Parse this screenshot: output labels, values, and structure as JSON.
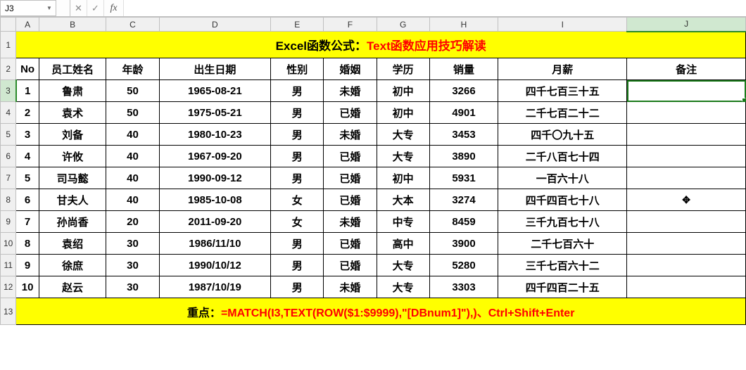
{
  "formula_bar": {
    "name_box": "J3",
    "cancel": "✕",
    "confirm": "✓",
    "fx": "fx",
    "formula_value": ""
  },
  "columns": [
    "A",
    "B",
    "C",
    "D",
    "E",
    "F",
    "G",
    "H",
    "I",
    "J"
  ],
  "row_numbers": [
    "1",
    "2",
    "3",
    "4",
    "5",
    "6",
    "7",
    "8",
    "9",
    "10",
    "11",
    "12",
    "13"
  ],
  "selected": {
    "col": "J",
    "row": "3",
    "cell": "J3"
  },
  "title": {
    "left": "Excel函数公式：",
    "right": "Text函数应用技巧解读"
  },
  "headers": {
    "A": "No",
    "B": "员工姓名",
    "C": "年龄",
    "D": "出生日期",
    "E": "性别",
    "F": "婚姻",
    "G": "学历",
    "H": "销量",
    "I": "月薪",
    "J": "备注"
  },
  "rows": [
    {
      "no": "1",
      "name": "鲁肃",
      "age": "50",
      "birth": "1965-08-21",
      "sex": "男",
      "mar": "未婚",
      "edu": "初中",
      "sales": "3266",
      "salary": "四千七百三十五",
      "note": ""
    },
    {
      "no": "2",
      "name": "袁术",
      "age": "50",
      "birth": "1975-05-21",
      "sex": "男",
      "mar": "已婚",
      "edu": "初中",
      "sales": "4901",
      "salary": "二千七百二十二",
      "note": ""
    },
    {
      "no": "3",
      "name": "刘备",
      "age": "40",
      "birth": "1980-10-23",
      "sex": "男",
      "mar": "未婚",
      "edu": "大专",
      "sales": "3453",
      "salary": "四千〇九十五",
      "note": ""
    },
    {
      "no": "4",
      "name": "许攸",
      "age": "40",
      "birth": "1967-09-20",
      "sex": "男",
      "mar": "已婚",
      "edu": "大专",
      "sales": "3890",
      "salary": "二千八百七十四",
      "note": ""
    },
    {
      "no": "5",
      "name": "司马懿",
      "age": "40",
      "birth": "1990-09-12",
      "sex": "男",
      "mar": "已婚",
      "edu": "初中",
      "sales": "5931",
      "salary": "一百六十八",
      "note": ""
    },
    {
      "no": "6",
      "name": "甘夫人",
      "age": "40",
      "birth": "1985-10-08",
      "sex": "女",
      "mar": "已婚",
      "edu": "大本",
      "sales": "3274",
      "salary": "四千四百七十八",
      "note": "✥"
    },
    {
      "no": "7",
      "name": "孙尚香",
      "age": "20",
      "birth": "2011-09-20",
      "sex": "女",
      "mar": "未婚",
      "edu": "中专",
      "sales": "8459",
      "salary": "三千九百七十八",
      "note": ""
    },
    {
      "no": "8",
      "name": "袁绍",
      "age": "30",
      "birth": "1986/11/10",
      "sex": "男",
      "mar": "已婚",
      "edu": "高中",
      "sales": "3900",
      "salary": "二千七百六十",
      "note": ""
    },
    {
      "no": "9",
      "name": "徐庶",
      "age": "30",
      "birth": "1990/10/12",
      "sex": "男",
      "mar": "已婚",
      "edu": "大专",
      "sales": "5280",
      "salary": "三千七百六十二",
      "note": ""
    },
    {
      "no": "10",
      "name": "赵云",
      "age": "30",
      "birth": "1987/10/19",
      "sex": "男",
      "mar": "未婚",
      "edu": "大专",
      "sales": "3303",
      "salary": "四千四百二十五",
      "note": ""
    }
  ],
  "footer": {
    "left": "重点：",
    "right": "=MATCH(I3,TEXT(ROW($1:$9999),\"[DBnum1]\"),)、Ctrl+Shift+Enter"
  }
}
